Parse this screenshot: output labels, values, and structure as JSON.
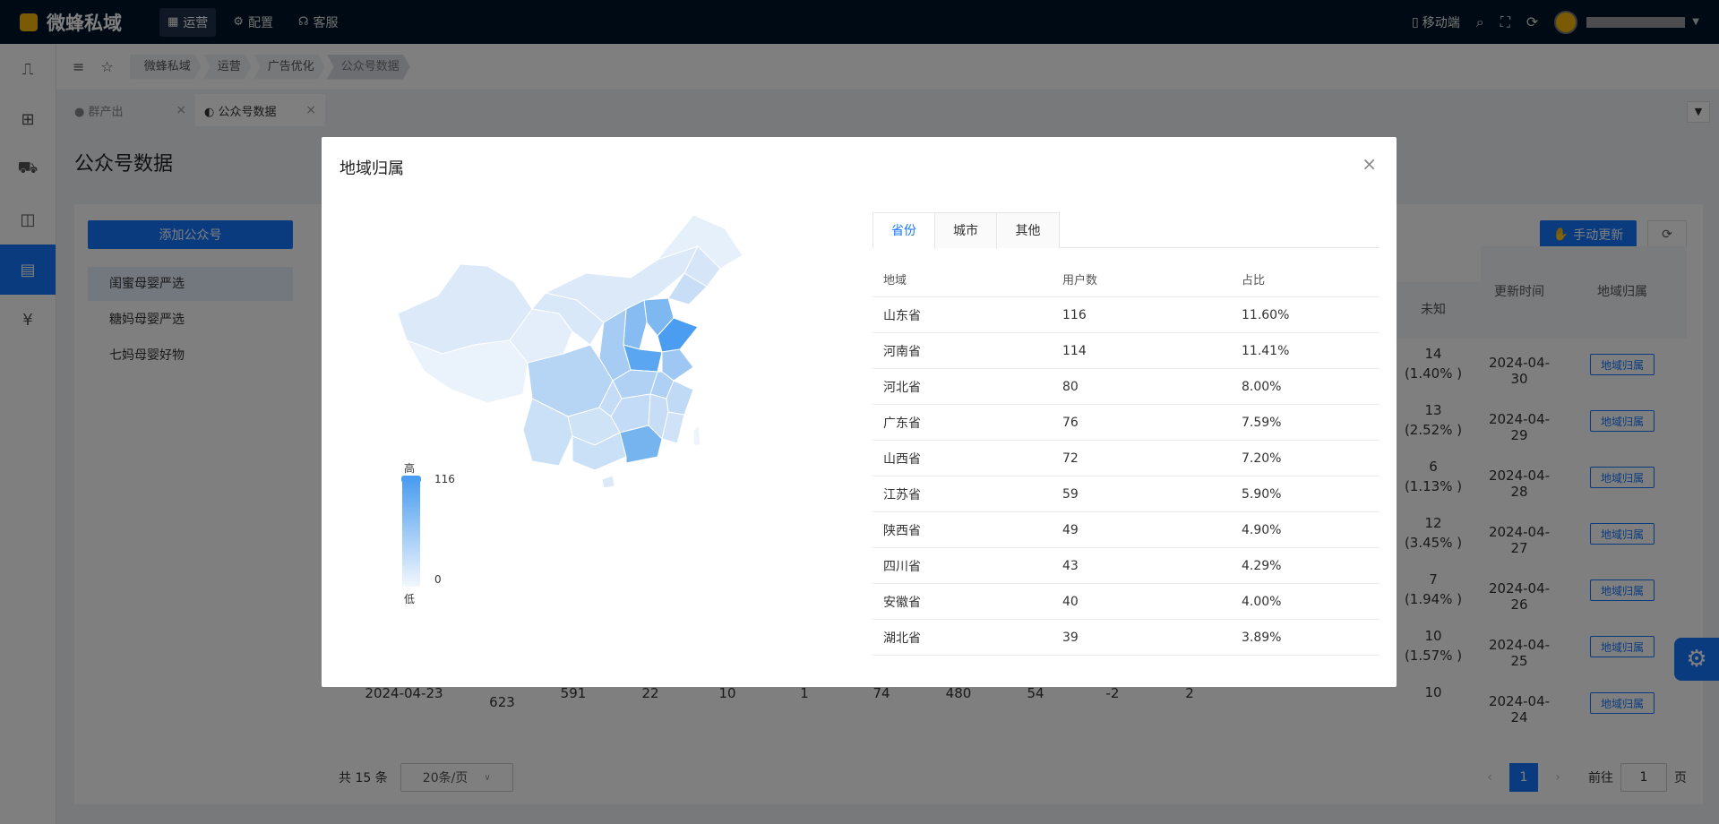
{
  "topbar": {
    "app_name": "微蜂私域",
    "nav": [
      {
        "label": "运营",
        "icon": "grid-icon",
        "active": true
      },
      {
        "label": "配置",
        "icon": "gear-icon",
        "active": false
      },
      {
        "label": "客服",
        "icon": "headset-icon",
        "active": false
      }
    ],
    "mobile_label": "移动端"
  },
  "breadcrumb": [
    "微蜂私域",
    "运营",
    "广告优化",
    "公众号数据"
  ],
  "tabs": [
    {
      "label": "群产出",
      "active": false
    },
    {
      "label": "公众号数据",
      "active": true
    }
  ],
  "page_title": "公众号数据",
  "add_account_label": "添加公众号",
  "accounts": [
    "闺蜜母婴严选",
    "糖妈母婴严选",
    "七妈母婴好物"
  ],
  "update_btn_label": "手动更新",
  "grid": {
    "headers": {
      "unknown": "未知",
      "update_time": "更新时间",
      "region": "地域归属"
    },
    "rows": [
      {
        "unknown": "14",
        "unknown_pct": "(1.40% )",
        "time": "2024-04-30"
      },
      {
        "unknown": "13",
        "unknown_pct": "(2.52% )",
        "time": "2024-04-29"
      },
      {
        "unknown": "6",
        "unknown_pct": "(1.13% )",
        "time": "2024-04-28"
      },
      {
        "unknown": "12",
        "unknown_pct": "(3.45% )",
        "time": "2024-04-27"
      },
      {
        "unknown": "7",
        "unknown_pct": "(1.94% )",
        "time": "2024-04-26"
      },
      {
        "unknown": "10",
        "unknown_pct": "(1.57% )",
        "time": "2024-04-25"
      },
      {
        "unknown": "10",
        "unknown_pct": "",
        "time": "2024-04-24"
      }
    ],
    "region_btn": "地域归属",
    "last_row": {
      "date": "2024-04-23",
      "v1": "623",
      "v2": "591",
      "v3": "22",
      "v4": "10",
      "v5": "1",
      "v6": "74",
      "v7": "480",
      "v8": "54",
      "v9": "-2",
      "v10": "2"
    }
  },
  "pager": {
    "total": "共 15 条",
    "size": "20条/页",
    "current": "1",
    "goto": "前往",
    "goto_value": "1",
    "page_suffix": "页"
  },
  "modal": {
    "title": "地域归属",
    "tabs": [
      {
        "label": "省份",
        "active": true
      },
      {
        "label": "城市",
        "active": false
      },
      {
        "label": "其他",
        "active": false
      }
    ],
    "columns": [
      "地域",
      "用户数",
      "占比"
    ],
    "rows": [
      {
        "region": "山东省",
        "users": "116",
        "pct": "11.60%"
      },
      {
        "region": "河南省",
        "users": "114",
        "pct": "11.41%"
      },
      {
        "region": "河北省",
        "users": "80",
        "pct": "8.00%"
      },
      {
        "region": "广东省",
        "users": "76",
        "pct": "7.59%"
      },
      {
        "region": "山西省",
        "users": "72",
        "pct": "7.20%"
      },
      {
        "region": "江苏省",
        "users": "59",
        "pct": "5.90%"
      },
      {
        "region": "陕西省",
        "users": "49",
        "pct": "4.90%"
      },
      {
        "region": "四川省",
        "users": "43",
        "pct": "4.29%"
      },
      {
        "region": "安徽省",
        "users": "40",
        "pct": "4.00%"
      },
      {
        "region": "湖北省",
        "users": "39",
        "pct": "3.89%"
      }
    ],
    "legend": {
      "high_label": "高",
      "low_label": "低",
      "max": "116",
      "min": "0"
    },
    "colors": {
      "high": "#4a9df0",
      "low": "#f2f7fd"
    }
  }
}
